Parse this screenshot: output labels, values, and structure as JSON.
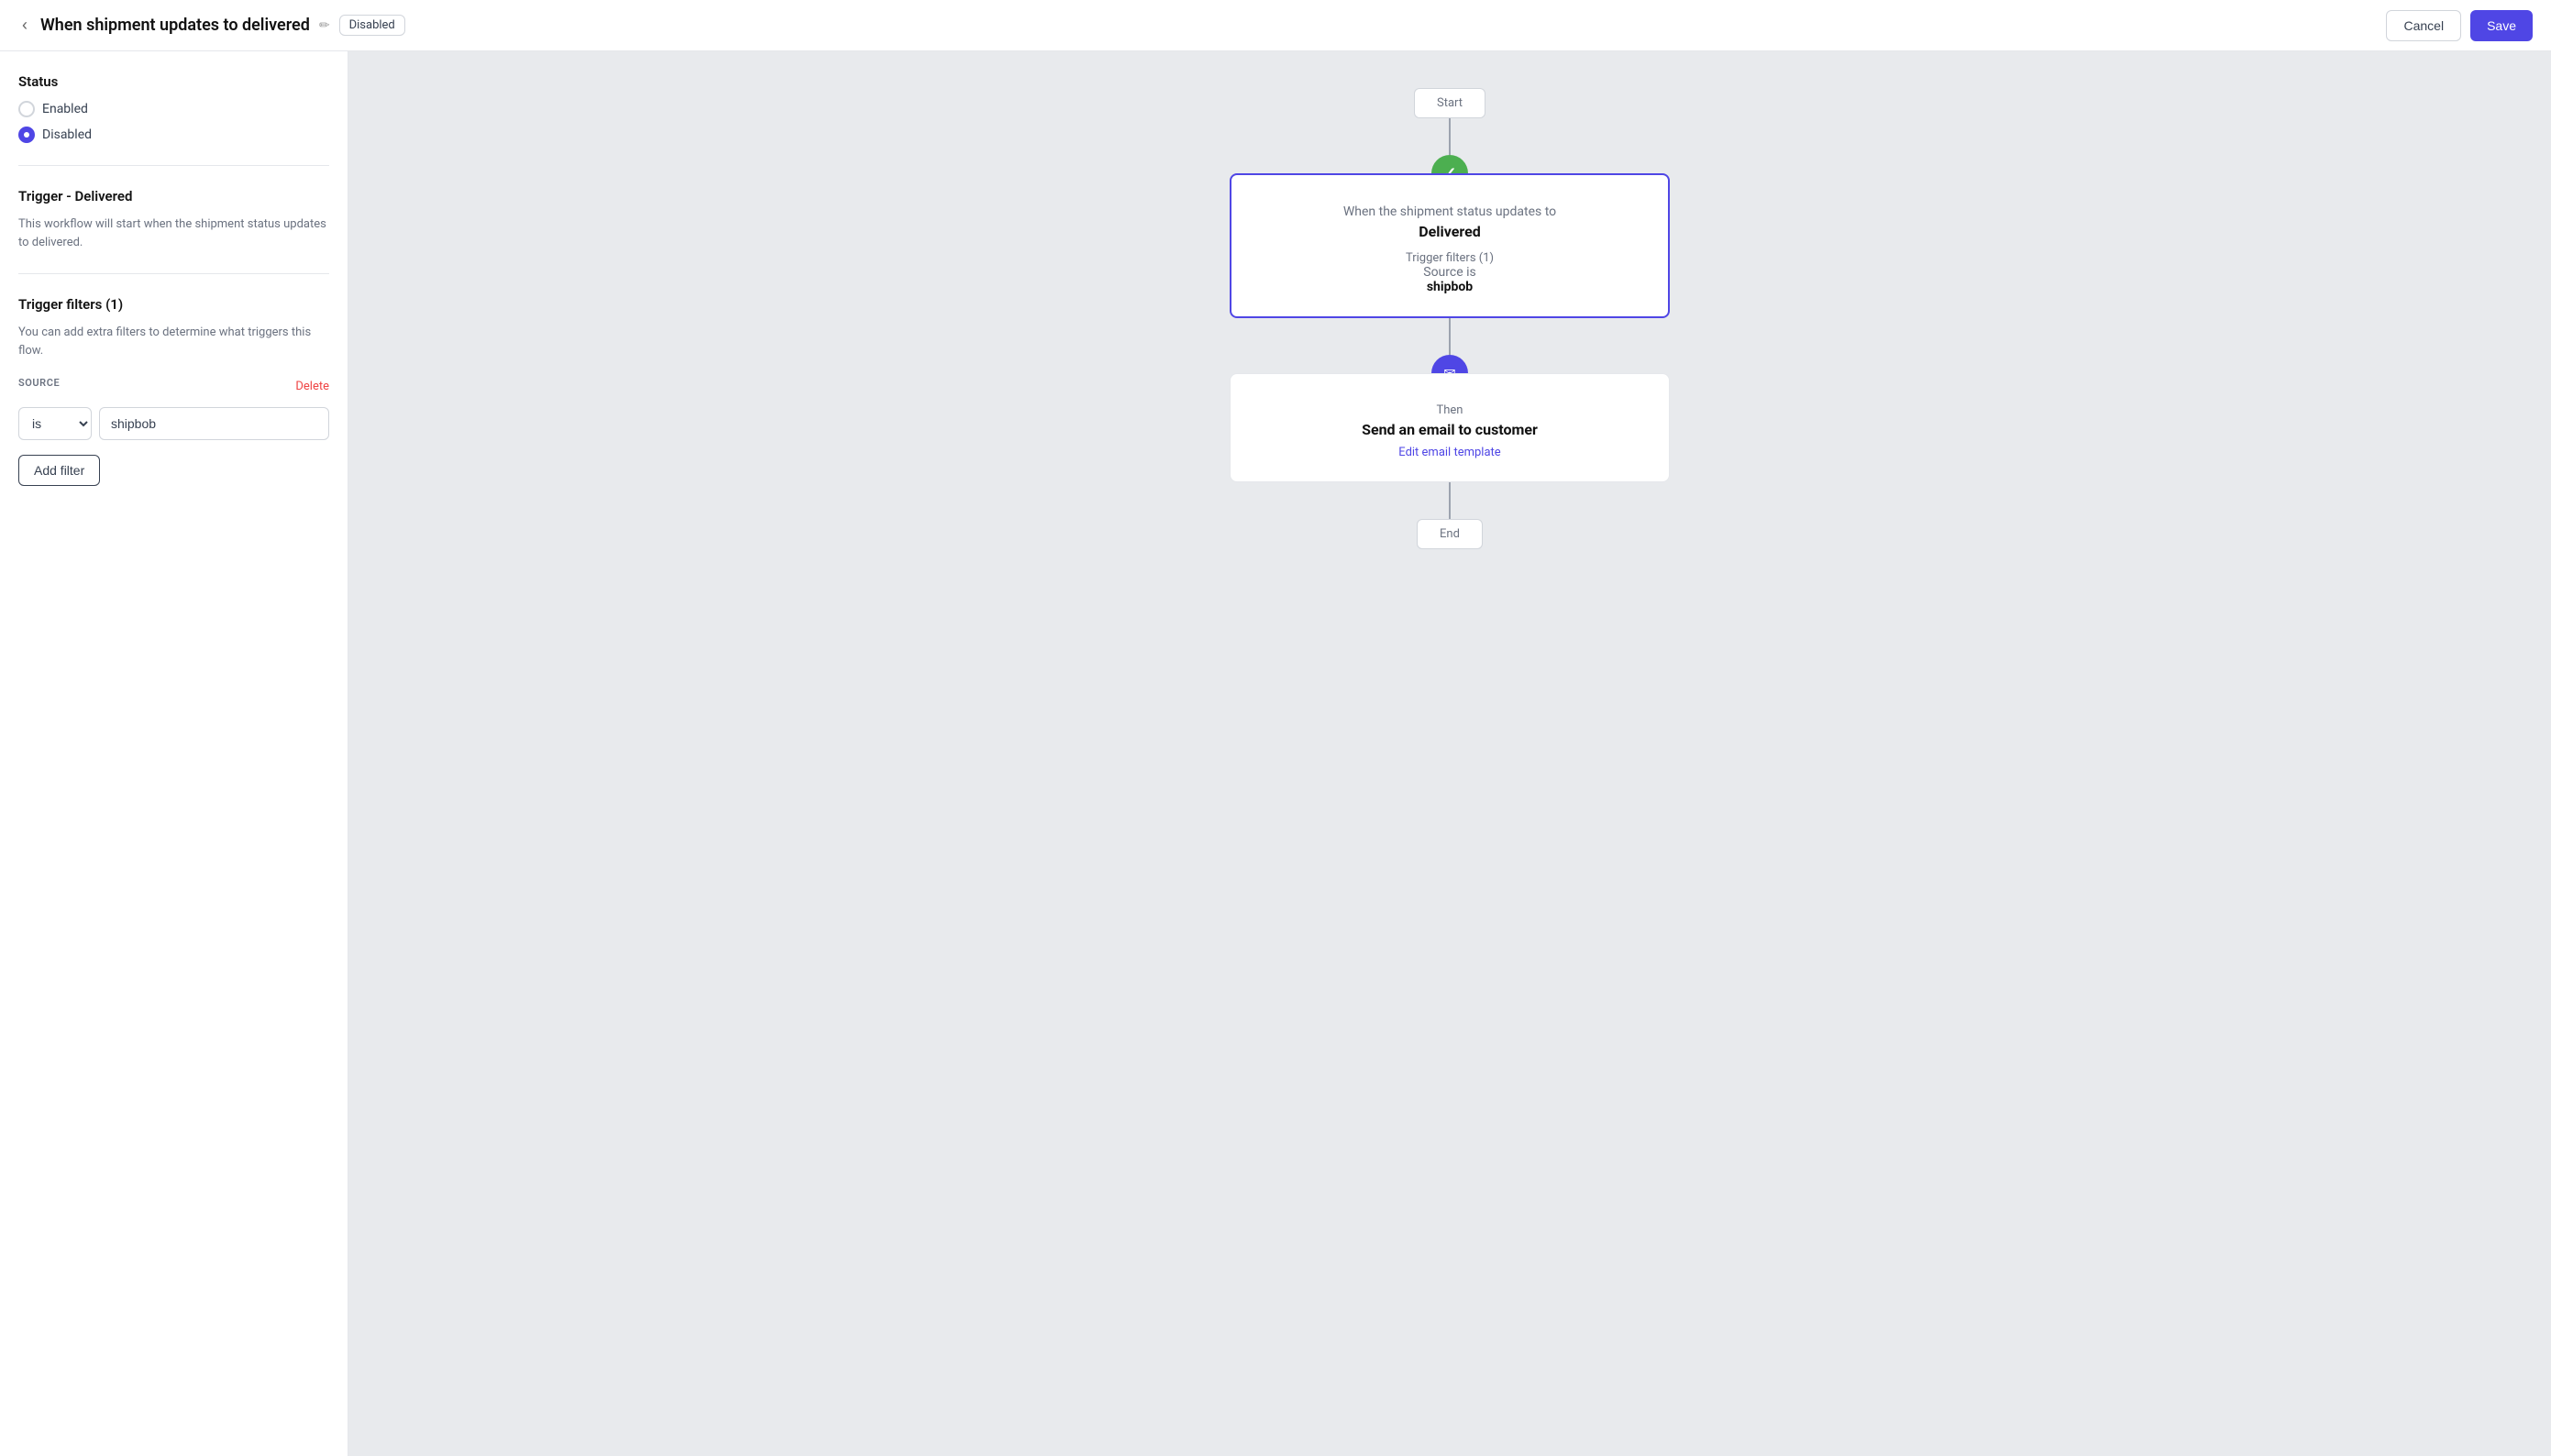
{
  "header": {
    "back_label": "‹",
    "title": "When shipment updates to delivered",
    "edit_icon": "✏",
    "status_badge": "Disabled",
    "cancel_label": "Cancel",
    "save_label": "Save"
  },
  "sidebar": {
    "status_section": {
      "title": "Status",
      "options": [
        {
          "id": "enabled",
          "label": "Enabled",
          "selected": false
        },
        {
          "id": "disabled",
          "label": "Disabled",
          "selected": true
        }
      ]
    },
    "trigger_section": {
      "title": "Trigger - Delivered",
      "description": "This workflow will start when the shipment status updates to delivered."
    },
    "filter_section": {
      "title": "Trigger filters (1)",
      "description": "You can add extra filters to determine what triggers this flow.",
      "filter_label": "SOURCE",
      "delete_label": "Delete",
      "filter_operator": "is",
      "filter_value": "shipbob",
      "add_filter_label": "Add filter"
    }
  },
  "canvas": {
    "start_label": "Start",
    "end_label": "End",
    "trigger_node": {
      "subtitle": "When the shipment status updates to",
      "title": "Delivered",
      "filter_title": "Trigger filters (1)",
      "filter_source_label": "Source is",
      "filter_source_value": "shipbob"
    },
    "action_node": {
      "then_label": "Then",
      "title": "Send an email to customer",
      "link_label": "Edit email template"
    }
  }
}
